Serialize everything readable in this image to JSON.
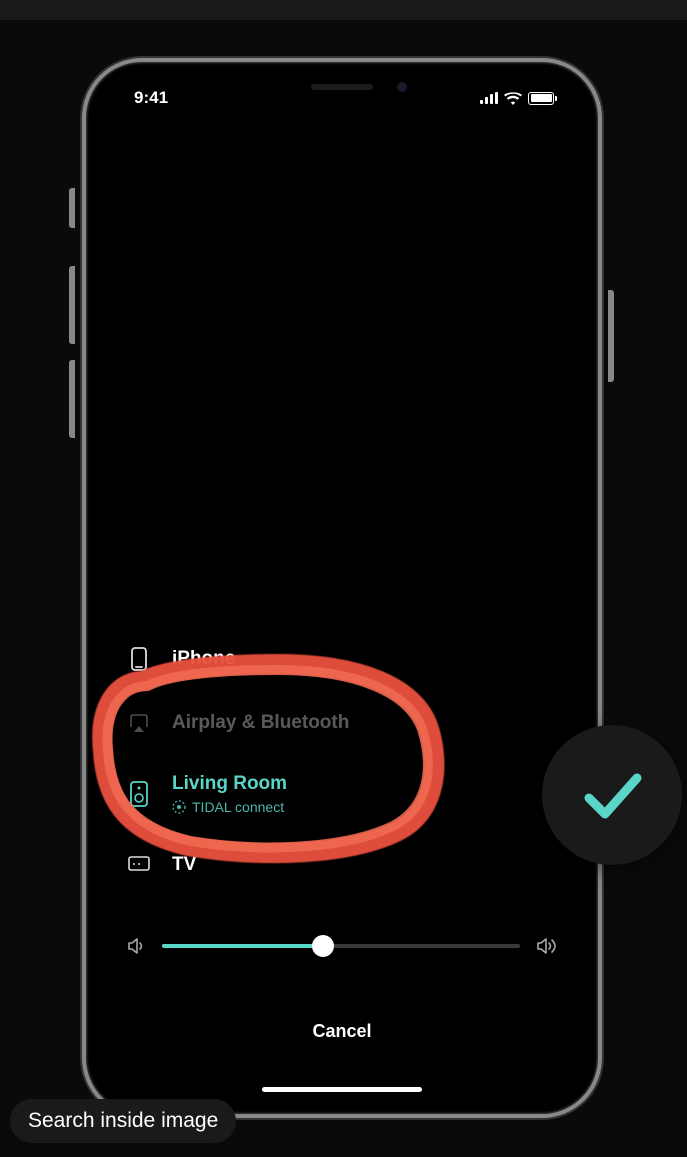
{
  "status_bar": {
    "time": "9:41"
  },
  "devices": [
    {
      "label": "iPhone",
      "icon": "phone"
    },
    {
      "label": "Airplay & Bluetooth",
      "icon": "airplay"
    },
    {
      "label": "Living Room",
      "sublabel": "TIDAL connect",
      "icon": "speaker",
      "selected": true
    },
    {
      "label": "TV",
      "icon": "tv"
    }
  ],
  "volume": {
    "percent": 45
  },
  "cancel_label": "Cancel",
  "search_chip": "Search inside image",
  "colors": {
    "accent": "#5ad6c8",
    "annotation": "#e74c3c"
  }
}
